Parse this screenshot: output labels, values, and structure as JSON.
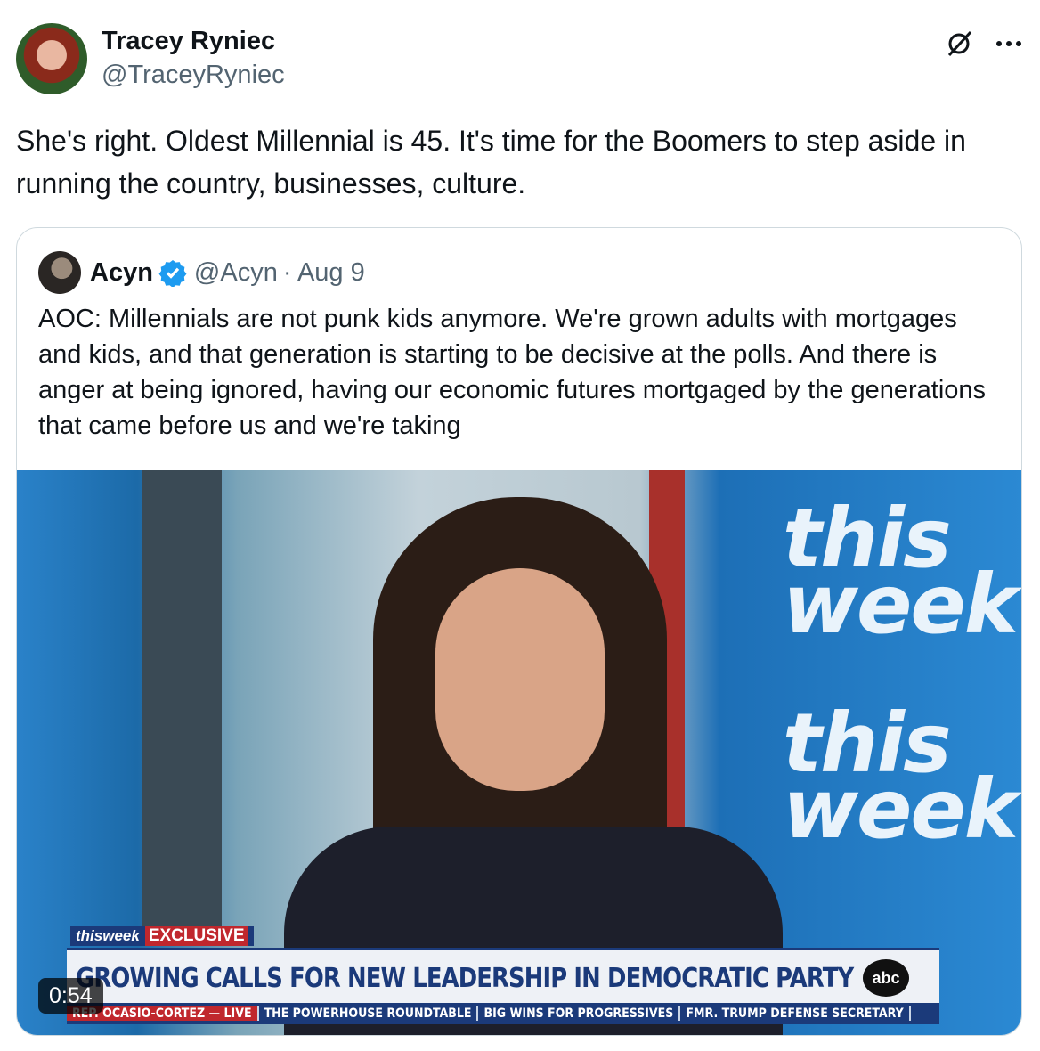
{
  "author": {
    "name": "Tracey Ryniec",
    "handle": "@TraceyRyniec"
  },
  "tweet": {
    "text": "She's right. Oldest Millennial is 45. It's time for the Boomers to step aside in running the country, businesses, culture."
  },
  "quoted": {
    "name": "Acyn",
    "handle": "@Acyn",
    "date": "· Aug 9",
    "text": "AOC: Millennials are not punk kids anymore. We're grown adults with mortgages and kids, and that generation is starting to be decisive at the polls. And there is anger at being ignored, having our economic futures mortgaged by the generations that came before us and we're taking",
    "video": {
      "duration": "0:54",
      "brand_show": "thisweek",
      "exclusive": "EXCLUSIVE",
      "headline": "GROWING CALLS FOR NEW LEADERSHIP IN DEMOCRATIC PARTY",
      "network": "abc",
      "bg_brand_1": "this week",
      "bg_brand_2": "this week",
      "ticker": [
        "REP. OCASIO-CORTEZ — LIVE",
        "THE POWERHOUSE ROUNDTABLE",
        "BIG WINS FOR PROGRESSIVES",
        "FMR. TRUMP DEFENSE SECRETARY"
      ]
    }
  },
  "colors": {
    "text": "#0f1419",
    "muted": "#536471",
    "verified": "#1d9bf0",
    "border": "#cfd9de"
  },
  "icons": [
    "grok-icon",
    "more-icon",
    "verified-badge-icon"
  ]
}
